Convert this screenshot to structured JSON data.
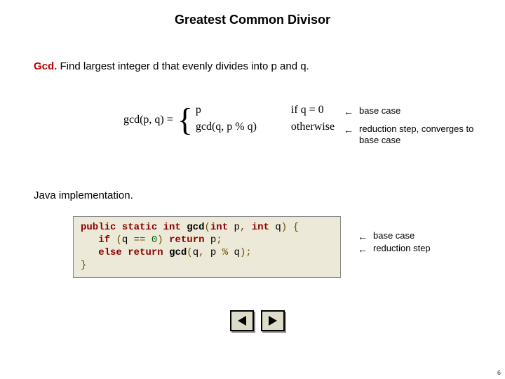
{
  "title": "Greatest Common Divisor",
  "intro": {
    "label": "Gcd.",
    "rest": "  Find largest integer d that evenly divides into p and q."
  },
  "math": {
    "lhs": "gcd(p, q) =",
    "case1_val": "p",
    "case1_cond": "if  q = 0",
    "case2_val": "gcd(q, p % q)",
    "case2_cond": "otherwise"
  },
  "annot_top1": "base case",
  "annot_top2": "reduction step,\nconverges to base case",
  "java_heading": "Java implementation.",
  "code": {
    "kw_public": "public",
    "kw_static": "static",
    "kw_int": "int",
    "fn": "gcd",
    "kw_if": "if",
    "kw_return": "return",
    "kw_else": "else",
    "zero": "0"
  },
  "annot_code1": "base case",
  "annot_code2": "reduction step",
  "page_number": "6"
}
